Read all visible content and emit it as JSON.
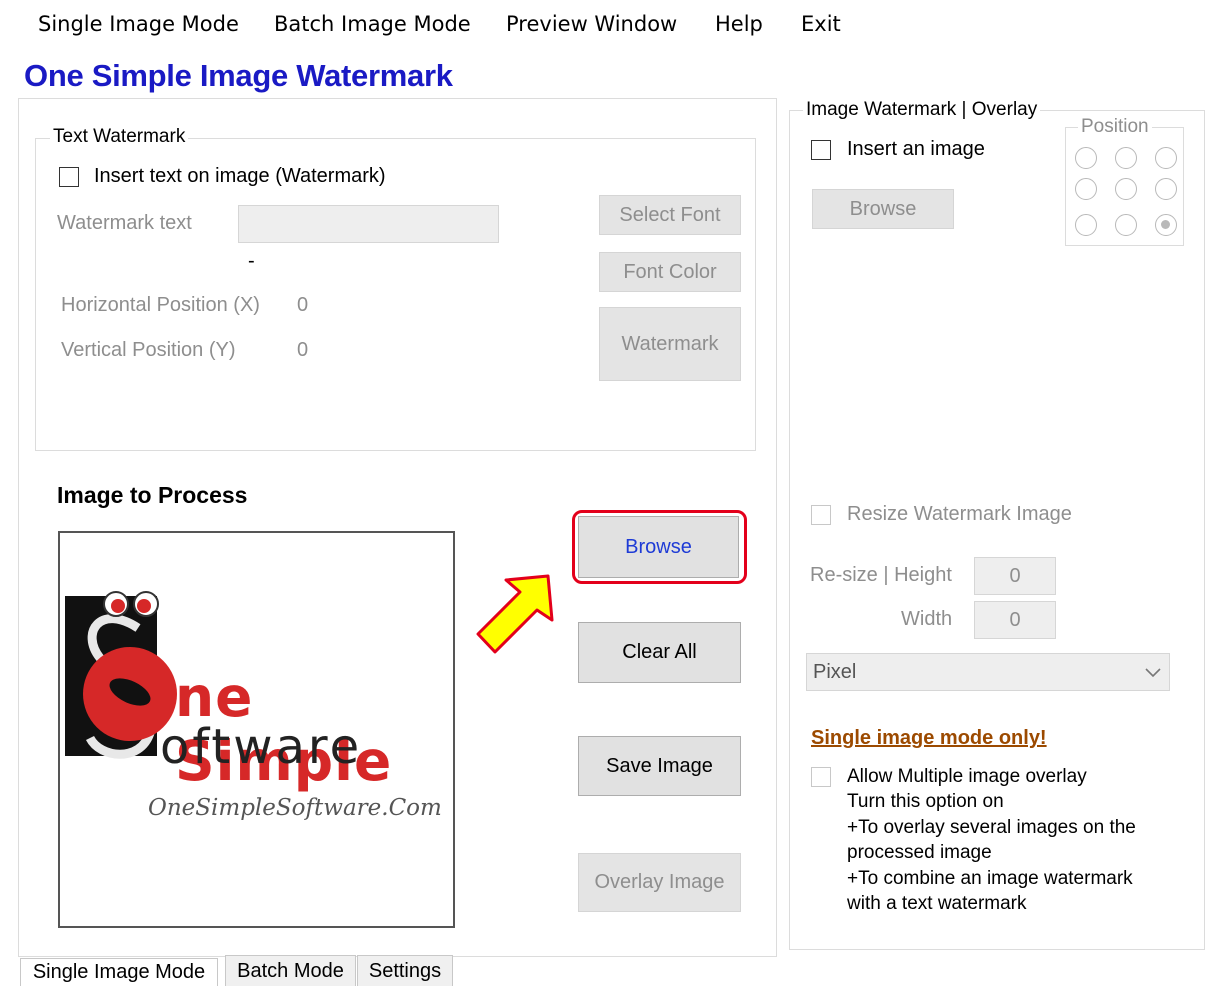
{
  "menu": [
    "Single Image Mode",
    "Batch Image Mode",
    "Preview Window",
    "Help",
    "Exit"
  ],
  "app_title": "One Simple Image Watermark",
  "text_watermark": {
    "legend": "Text Watermark",
    "insert_checkbox_label": "Insert text on image (Watermark)",
    "watermark_text_label": "Watermark text",
    "watermark_text_value": "",
    "preview_dash": "-",
    "horizontal_label": "Horizontal Position (X)",
    "horizontal_value": "0",
    "vertical_label": "Vertical Position (Y)",
    "vertical_value": "0",
    "select_font_button": "Select Font",
    "font_color_button": "Font Color",
    "watermark_button": "Watermark"
  },
  "image_to_process": {
    "heading": "Image to Process",
    "logo_line1": "ne Simple",
    "logo_line2": "oftware",
    "logo_url_text": "OneSimpleSoftware.Com"
  },
  "actions": {
    "browse": "Browse",
    "clear_all": "Clear All",
    "save_image": "Save Image",
    "overlay_image": "Overlay Image"
  },
  "image_watermark": {
    "legend": "Image Watermark | Overlay",
    "insert_checkbox_label": "Insert an image",
    "browse_button": "Browse",
    "position_legend": "Position",
    "position_selected": 9,
    "resize_checkbox_label": "Resize Watermark Image",
    "resize_height_label": "Re-size | Height",
    "resize_height_value": "0",
    "resize_width_label": "Width",
    "resize_width_value": "0",
    "unit_select_value": "Pixel",
    "single_mode_note": "Single image mode only!",
    "multi_overlay_label": "Allow Multiple image overlay",
    "multi_overlay_lines": [
      "Turn this option on",
      "+To overlay several images on the",
      "processed image",
      "+To combine an image watermark",
      "with a text watermark"
    ]
  },
  "tabs": [
    "Single Image Mode",
    "Batch Mode",
    "Settings"
  ],
  "colors": {
    "title": "#1a1ac4",
    "highlight_border": "#e3001b",
    "arrow_fill": "#ffff00",
    "logo_red": "#d62828"
  }
}
